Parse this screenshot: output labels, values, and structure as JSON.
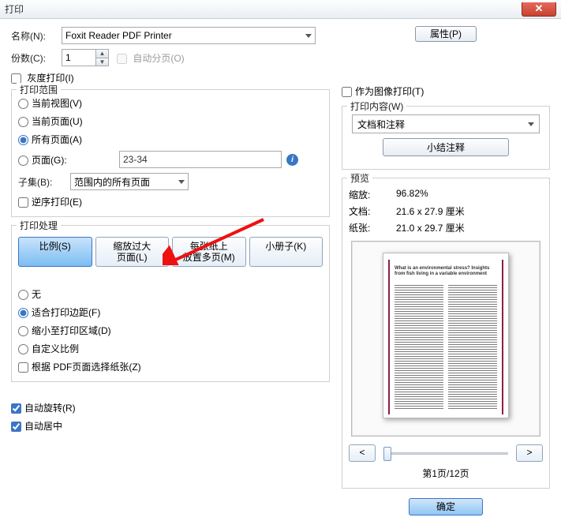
{
  "window": {
    "title": "打印",
    "close": "✕"
  },
  "labels": {
    "name": "名称(N):",
    "copies": "份数(C):",
    "collate": "自动分页(O)",
    "grayscale": "灰度打印(I)",
    "asImage": "作为图像打印(T)",
    "printContent": "打印内容(W)",
    "summarize": "小结注释",
    "preview": "预览",
    "zoom": "缩放:",
    "doc": "文档:",
    "paper": "纸张:"
  },
  "printer": {
    "selected": "Foxit Reader PDF Printer"
  },
  "buttons": {
    "properties": "属性(P)",
    "ok": "确定",
    "prev": "<",
    "next": ">"
  },
  "copies": {
    "value": "1"
  },
  "checks": {
    "grayscale": false,
    "asImage": false,
    "collate_disabled": true,
    "reverse": false,
    "pdfPageSize": false,
    "autoRotate": true,
    "autoCenter": true
  },
  "range": {
    "legend": "打印范围",
    "currentView": "当前视图(V)",
    "currentPage": "当前页面(U)",
    "allPages": "所有页面(A)",
    "pages": "页面(G):",
    "pagesValue": "23-34",
    "subsetLabel": "子集(B):",
    "subsetValue": "范围内的所有页面",
    "reverse": "逆序打印(E)"
  },
  "handling": {
    "legend": "打印处理",
    "scale": "比例(S)",
    "fit": "缩放过大\n页面(L)",
    "multiple": "每张纸上\n放置多页(M)",
    "booklet": "小册子(K)",
    "none": "无",
    "fitMargins": "适合打印边距(F)",
    "shrink": "缩小至打印区域(D)",
    "custom": "自定义比例",
    "pdfPageSize": "根据 PDF页面选择纸张(Z)",
    "autoRotate": "自动旋转(R)",
    "autoCenter": "自动居中"
  },
  "content": {
    "selected": "文档和注释"
  },
  "preview": {
    "zoomValue": "96.82%",
    "docSize": "21.6 x 27.9 厘米",
    "paperSize": "21.0 x 29.7 厘米",
    "pager": "第1页/12页",
    "docTitle": "What is an environmental stress? Insights from fish living in a variable environment"
  }
}
